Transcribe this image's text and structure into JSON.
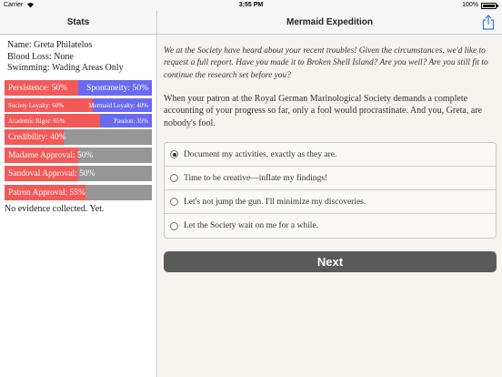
{
  "status_bar": {
    "carrier": "Carrier",
    "time": "3:55 PM",
    "battery": "100%"
  },
  "left_nav": {
    "title": "Stats"
  },
  "right_nav": {
    "title": "Mermaid Expedition"
  },
  "stats": {
    "lines": [
      "Name: Greta Philatelos",
      "Blood Loss: None",
      "Swimming: Wading Areas Only"
    ],
    "bars": [
      {
        "type": "opposed",
        "left_label": "Persistence: 50%",
        "right_label": "Spontaneity: 50%",
        "value": 0.5,
        "left_color": "#f25a5a",
        "right_color": "#6a6af0",
        "size": "full"
      },
      {
        "type": "opposed",
        "left_label": "Society Loyalty: 60%",
        "right_label": "Mermaid Loyalty: 40%",
        "value": 0.6,
        "left_color": "#f25a5a",
        "right_color": "#6a6af0",
        "size": "small"
      },
      {
        "type": "opposed",
        "left_label": "Academic Rigor: 65%",
        "right_label": "Passion: 35%",
        "value": 0.65,
        "left_color": "#f25a5a",
        "right_color": "#6a6af0",
        "size": "small"
      },
      {
        "type": "single",
        "label": "Credibility: 40%",
        "value": 0.4,
        "color": "#f25a5a",
        "size": "full"
      },
      {
        "type": "single",
        "label": "Madame Approval: 50%",
        "value": 0.5,
        "color": "#f25a5a",
        "size": "full"
      },
      {
        "type": "single",
        "label": "Sandoval Approval: 50%",
        "value": 0.5,
        "color": "#f25a5a",
        "size": "full"
      },
      {
        "type": "single",
        "label": "Patron Approval: 55%",
        "value": 0.55,
        "color": "#f25a5a",
        "size": "full"
      }
    ],
    "evidence": "No evidence collected. Yet."
  },
  "story": {
    "intro_italic": "We at the Society have heard about your recent troubles! Given the circumstances, we'd like to request a full report. Have you made it to Broken Shell Island? Are you well? Are you still fit to continue the research set before you?",
    "intro_body": "When your patron at the Royal German Marinological Society demands a complete accounting of your progress so far, only a fool would procrastinate. And you, Greta, are nobody's fool.",
    "choices": [
      {
        "label": "Document my activities, exactly as they are.",
        "selected": true
      },
      {
        "label": "Time to be creative—inflate my findings!",
        "selected": false
      },
      {
        "label": "Let's not jump the gun. I'll minimize my discoveries.",
        "selected": false
      },
      {
        "label": "Let the Society wait on me for a while.",
        "selected": false
      }
    ],
    "next_label": "Next"
  },
  "colors": {
    "red": "#f25a5a",
    "blue": "#6a6af0",
    "grey": "#969696",
    "button": "#5a5a5a"
  }
}
